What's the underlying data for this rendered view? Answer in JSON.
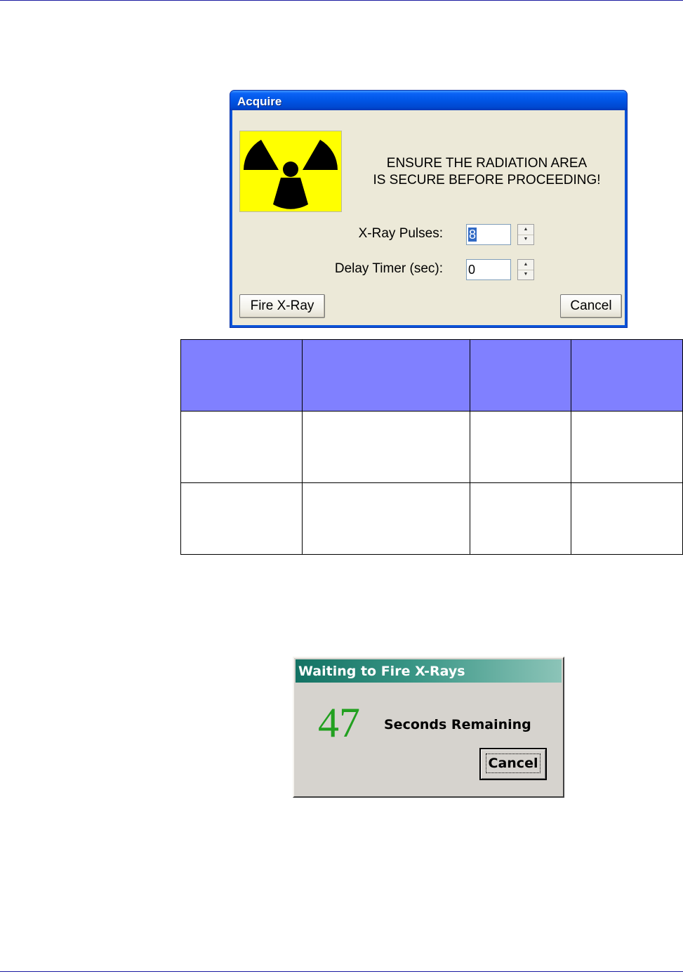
{
  "acquire_dialog": {
    "title": "Acquire",
    "warning_line1": "ENSURE THE RADIATION AREA",
    "warning_line2": "IS SECURE BEFORE PROCEEDING!",
    "pulses_label": "X-Ray Pulses:",
    "pulses_value": "8",
    "delay_label": "Delay Timer (sec):",
    "delay_value": "0",
    "fire_button": "Fire X-Ray",
    "cancel_button": "Cancel",
    "icon": "radiation-trefoil-icon",
    "colors": {
      "title_bar": "#0055e5",
      "icon_background": "#ffff00",
      "body": "#ece9d8"
    }
  },
  "table": {
    "header_color": "#8080ff",
    "columns": [
      "",
      "",
      "",
      ""
    ],
    "rows": [
      [
        "",
        "",
        "",
        ""
      ],
      [
        "",
        "",
        "",
        ""
      ]
    ]
  },
  "wait_dialog": {
    "title": "Waiting to Fire X-Rays",
    "countdown": "47",
    "remaining_label": "Seconds Remaining",
    "cancel_button": "Cancel",
    "colors": {
      "countdown": "#22a020",
      "title_bar": "#137263"
    }
  }
}
